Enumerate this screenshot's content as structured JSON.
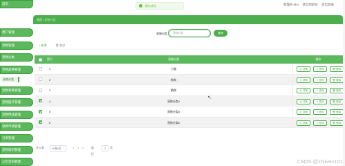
{
  "sidebar": {
    "items": [
      {
        "label": "首页"
      },
      {
        "label": "用户管理"
      },
      {
        "label": "宠物管理"
      },
      {
        "label": "宠物分类"
      },
      {
        "label": "宠物品种管理"
      },
      {
        "label": "品种分类"
      },
      {
        "label": "宠物寄养管理"
      },
      {
        "label": "宠物医疗管理"
      },
      {
        "label": "宠物用品管理"
      },
      {
        "label": "领养申请管理"
      },
      {
        "label": "订单管理"
      },
      {
        "label": "宠物知识管理"
      },
      {
        "label": "公告资讯管理"
      },
      {
        "label": "系统管理"
      }
    ],
    "active_sub": "宠物分类"
  },
  "header": {
    "user_role": "管理员 abo",
    "links": [
      "退出到前台",
      "退出登录"
    ]
  },
  "toast": {
    "message": "操作成功"
  },
  "breadcrumb": {
    "home": "首页",
    "current": "宠物分类"
  },
  "search": {
    "label": "宠物分类",
    "placeholder": "宠物分类",
    "button": "查询"
  },
  "toolbar": {
    "add": "+ 新增",
    "delete": "删除"
  },
  "table": {
    "headers": {
      "index": "索引",
      "name": "宠物分类",
      "actions": "操作"
    },
    "rows": [
      {
        "index": "1",
        "name": "小猫",
        "checked": false
      },
      {
        "index": "2",
        "name": "狗狗",
        "checked": false
      },
      {
        "index": "3",
        "name": "鹦鹉",
        "checked": false
      },
      {
        "index": "4",
        "name": "宠物分类4",
        "checked": true
      },
      {
        "index": "5",
        "name": "宠物分类5",
        "checked": true
      },
      {
        "index": "6",
        "name": "宠物分类6",
        "checked": true
      }
    ],
    "row_actions": [
      "详情",
      "修改",
      "删除"
    ]
  },
  "pagination": {
    "total": "共 6 条",
    "page_size": "10条/页",
    "prev": "<",
    "current_page": "1",
    "next": ">",
    "goto_label": "前往",
    "goto_value": "1",
    "page_unit": "页"
  },
  "watermark": "CSDN @zhiwen101",
  "colors": {
    "accent": "#4cae4c",
    "header": "#5cb85c",
    "toast": "#67c23a"
  }
}
